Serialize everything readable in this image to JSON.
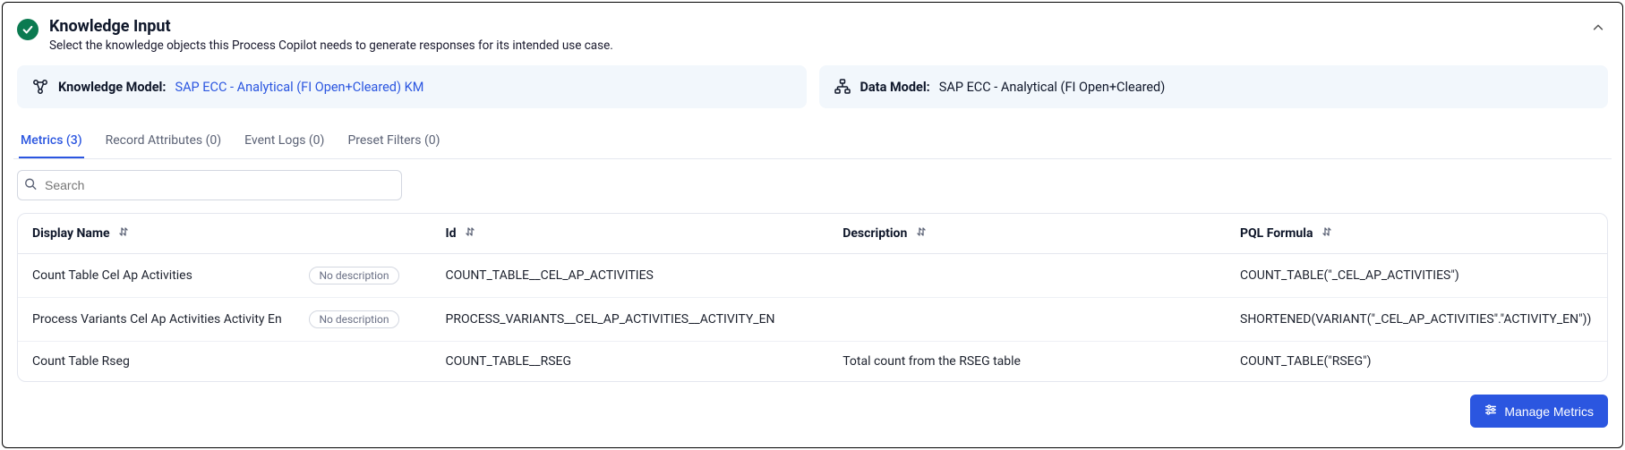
{
  "header": {
    "title": "Knowledge Input",
    "subtitle": "Select the knowledge objects this Process Copilot needs to generate responses for its intended use case."
  },
  "models": {
    "knowledge_label": "Knowledge Model:",
    "knowledge_value": "SAP ECC - Analytical (FI Open+Cleared) KM",
    "data_label": "Data Model:",
    "data_value": "SAP ECC - Analytical (FI Open+Cleared)"
  },
  "tabs": [
    {
      "label": "Metrics (3)",
      "active": true
    },
    {
      "label": "Record Attributes (0)",
      "active": false
    },
    {
      "label": "Event Logs (0)",
      "active": false
    },
    {
      "label": "Preset Filters (0)",
      "active": false
    }
  ],
  "search": {
    "placeholder": "Search"
  },
  "table": {
    "headers": {
      "name": "Display Name",
      "id": "Id",
      "desc": "Description",
      "pql": "PQL Formula"
    },
    "no_description_badge": "No description",
    "rows": [
      {
        "name": "Count Table Cel Ap Activities",
        "no_desc": true,
        "id": "COUNT_TABLE__CEL_AP_ACTIVITIES",
        "desc": "",
        "pql": "COUNT_TABLE(\"_CEL_AP_ACTIVITIES\")"
      },
      {
        "name": "Process Variants Cel Ap Activities Activity En",
        "no_desc": true,
        "id": "PROCESS_VARIANTS__CEL_AP_ACTIVITIES__ACTIVITY_EN",
        "desc": "",
        "pql": "SHORTENED(VARIANT(\"_CEL_AP_ACTIVITIES\".\"ACTIVITY_EN\"))"
      },
      {
        "name": "Count Table Rseg",
        "no_desc": false,
        "id": "COUNT_TABLE__RSEG",
        "desc": "Total count from the RSEG table",
        "pql": "COUNT_TABLE(\"RSEG\")"
      }
    ]
  },
  "footer": {
    "manage_label": "Manage Metrics"
  }
}
